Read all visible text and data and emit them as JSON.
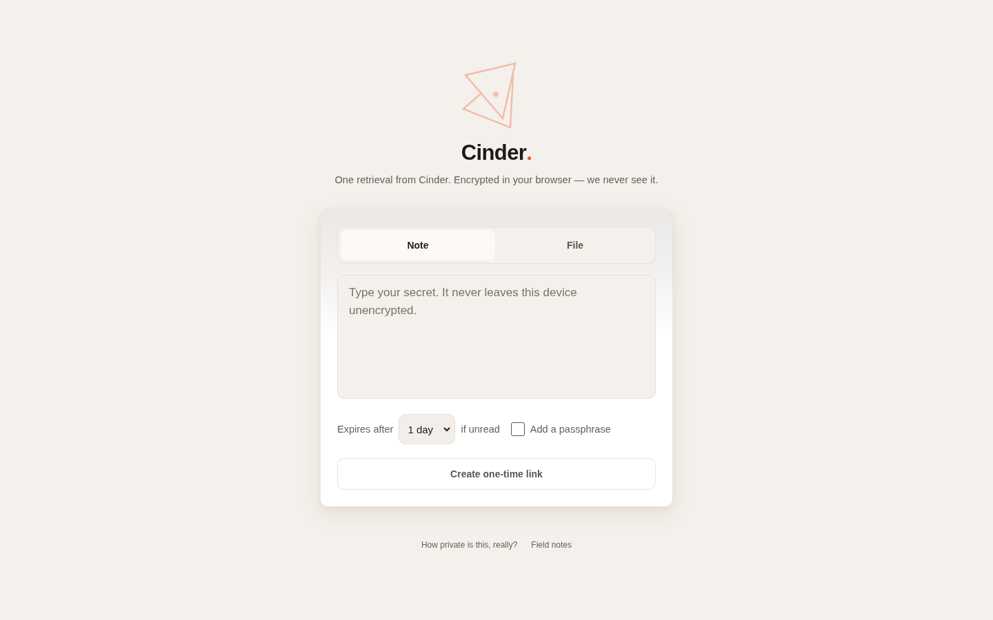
{
  "brand": {
    "name": "Cinder",
    "accent": "."
  },
  "tagline": "One retrieval from Cinder. Encrypted in your browser — we never see it.",
  "card": {
    "tabs": [
      {
        "label": "Note",
        "selected": true
      },
      {
        "label": "File",
        "selected": false
      }
    ],
    "message": {
      "placeholder": "Type your secret. It never leaves this device unencrypted."
    },
    "expiry": {
      "label_before": "Expires after",
      "value": "1 day",
      "label_after": "if unread"
    },
    "passphrase": {
      "label": "Add a passphrase",
      "checked": false
    },
    "submit": {
      "label": "Create one-time link"
    }
  },
  "footer_links": [
    "How private is this, really?",
    "Field notes"
  ]
}
